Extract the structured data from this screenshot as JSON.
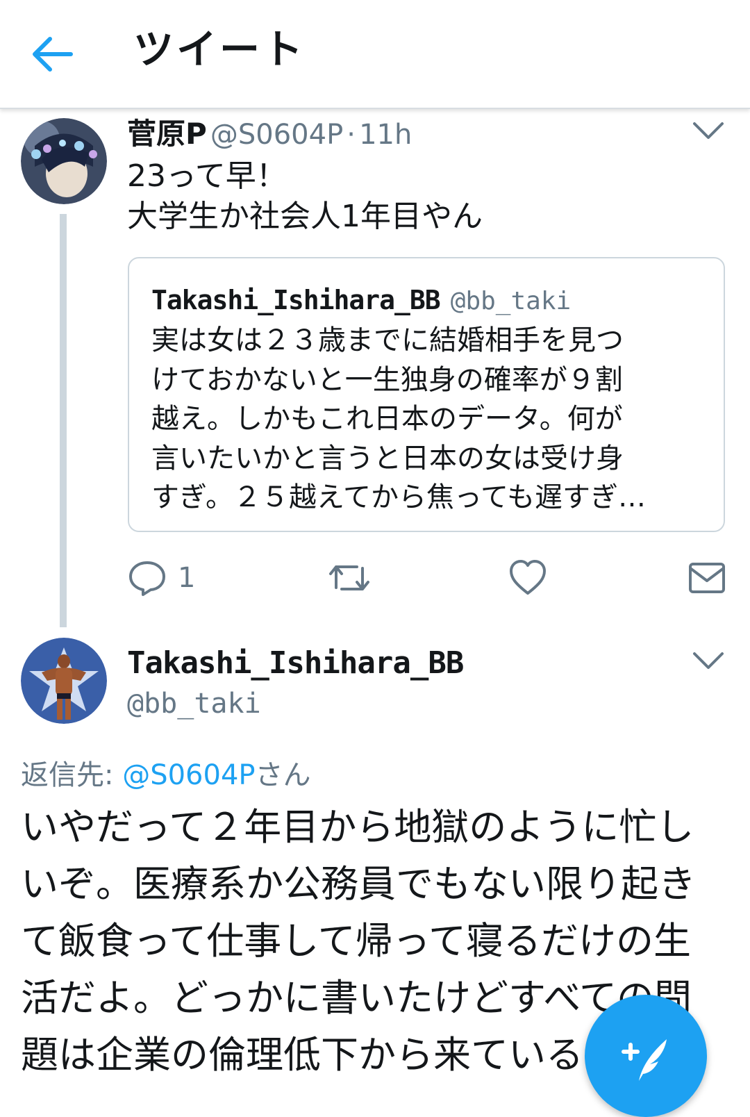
{
  "header": {
    "back_icon": "arrow-left-icon",
    "title": "ツイート"
  },
  "colors": {
    "accent": "#1da1f2",
    "secondary_text": "#657786",
    "border": "#ccd6dd"
  },
  "tweet1": {
    "display_name": "菅原P",
    "handle": "@S0604P",
    "separator": "·",
    "time": "11h",
    "text_lines": [
      "23って早！",
      "大学生か社会人1年目やん"
    ],
    "quote": {
      "display_name": "Takashi_Ishihara_BB",
      "handle": "@bb_taki",
      "text_lines": [
        "実は女は２３歳までに結婚相手を見つ",
        "けておかないと一生独身の確率が９割",
        "越え。しかもこれ日本のデータ。何が",
        "言いたいかと言うと日本の女は受け身",
        "すぎ。２５越えてから焦っても遅すぎ…"
      ]
    },
    "actions": {
      "reply_count": "1"
    }
  },
  "tweet2": {
    "display_name": "Takashi_Ishihara_BB",
    "handle": "@bb_taki",
    "replying_label": "返信先:",
    "replying_mention": "@S0604P",
    "replying_suffix": "さん",
    "body_lines": [
      "いやだって２年目から地獄のように忙し",
      "いぞ。医療系か公務員でもない限り起き",
      "て飯食って仕事して帰って寝るだけの生",
      "活だよ。どっかに書いたけどすべての問",
      "題は企業の倫理低下から来ているので"
    ]
  },
  "fab": {
    "icon": "compose-tweet-icon"
  }
}
